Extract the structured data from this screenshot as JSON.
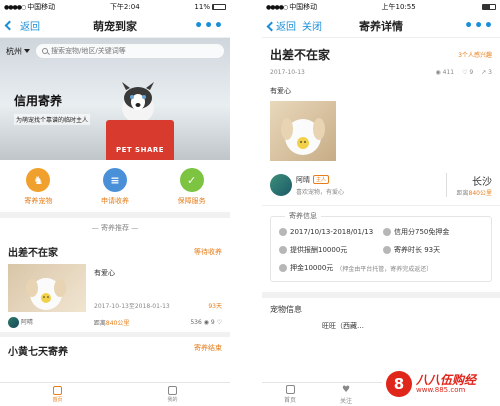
{
  "left": {
    "status": {
      "carrier": "中国移动",
      "time": "下午2:04",
      "battery": "11%",
      "battery_level": 0.11
    },
    "nav": {
      "back": "返回",
      "title": "萌宠到家",
      "more": "•••"
    },
    "search": {
      "city": "杭州",
      "placeholder": "搜索宠物/地区/关键词等"
    },
    "banner": {
      "title": "信用寄养",
      "subtitle": "为萌宠找个靠谱的临时主人",
      "cart_logo": "PET SHARE"
    },
    "categories": [
      {
        "label": "寄养宠物",
        "icon": "pet-icon",
        "color": "#f0a02c",
        "glyph": "♞"
      },
      {
        "label": "申请收养",
        "icon": "document-icon",
        "color": "#4a90d9",
        "glyph": "≡"
      },
      {
        "label": "保障服务",
        "icon": "shield-check-icon",
        "color": "#7cc441",
        "glyph": "✓"
      }
    ],
    "section": "寄养推荐",
    "card1": {
      "title": "出差不在家",
      "status": "等待收养",
      "desc": "有爱心",
      "date": "2017-10-13至2018-01-13",
      "days": "93天",
      "owner": "阿晴",
      "distance_prefix": "距离",
      "distance": "840公里",
      "views": "536",
      "likes": "9"
    },
    "card2": {
      "title": "小黄七天寄养",
      "status": "寄养结束"
    },
    "tabs": {
      "home": "首页",
      "mine": "我的"
    }
  },
  "right": {
    "status": {
      "carrier": "中国移动",
      "time": "上午10:55",
      "battery_level": 0.6
    },
    "nav": {
      "back": "返回",
      "close": "关闭",
      "title": "寄养详情",
      "more": "•••"
    },
    "detail": {
      "title": "出差不在家",
      "interest": "3个人感兴趣",
      "date": "2017-10-13",
      "views": "411",
      "likes": "9",
      "shares": "3",
      "desc": "有爱心"
    },
    "owner": {
      "name": "阿晴",
      "tag": "主人",
      "note": "喜欢宠物，有爱心",
      "city": "长沙",
      "distance_prefix": "距离",
      "distance": "840公里"
    },
    "info": {
      "label": "寄养信息",
      "period": "2017/10/13-2018/01/13",
      "credit": "信用分750免押金",
      "reward": "提供报酬10000元",
      "duration": "寄养时长 93天",
      "deposit": "押金10000元",
      "deposit_note": "（押金由平台托管，寄养完成返还）"
    },
    "pet_info": "宠物信息",
    "pet_name_preview": "旺旺（西藏…",
    "tabs": {
      "home": "首页",
      "follow": "关注"
    }
  },
  "watermark": {
    "logo": "8",
    "text": "八八伍购经",
    "url": "www.885.com"
  },
  "colors": {
    "accent": "#e67e1a",
    "link": "#1a8fd8",
    "brand_red": "#d83a2e"
  }
}
